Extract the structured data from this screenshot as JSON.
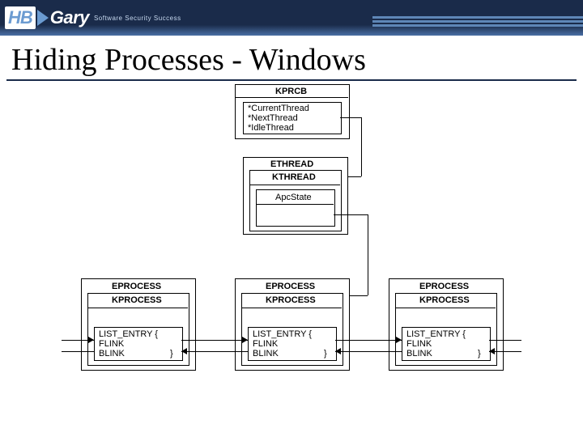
{
  "header": {
    "logo_left": "HB",
    "logo_right": "Gary",
    "tagline": "Software Security Success"
  },
  "title": "Hiding Processes - Windows",
  "kprcb": {
    "title": "KPRCB",
    "fields": [
      "*CurrentThread",
      "*NextThread",
      "*IdleThread"
    ]
  },
  "ethread": {
    "title": "ETHREAD",
    "inner": "KTHREAD",
    "field": "ApcState"
  },
  "eprocess": {
    "title": "EPROCESS",
    "inner": "KPROCESS",
    "list_entry_open": "LIST_ENTRY {",
    "flink": "FLINK",
    "blink": "BLINK",
    "close": "}"
  }
}
